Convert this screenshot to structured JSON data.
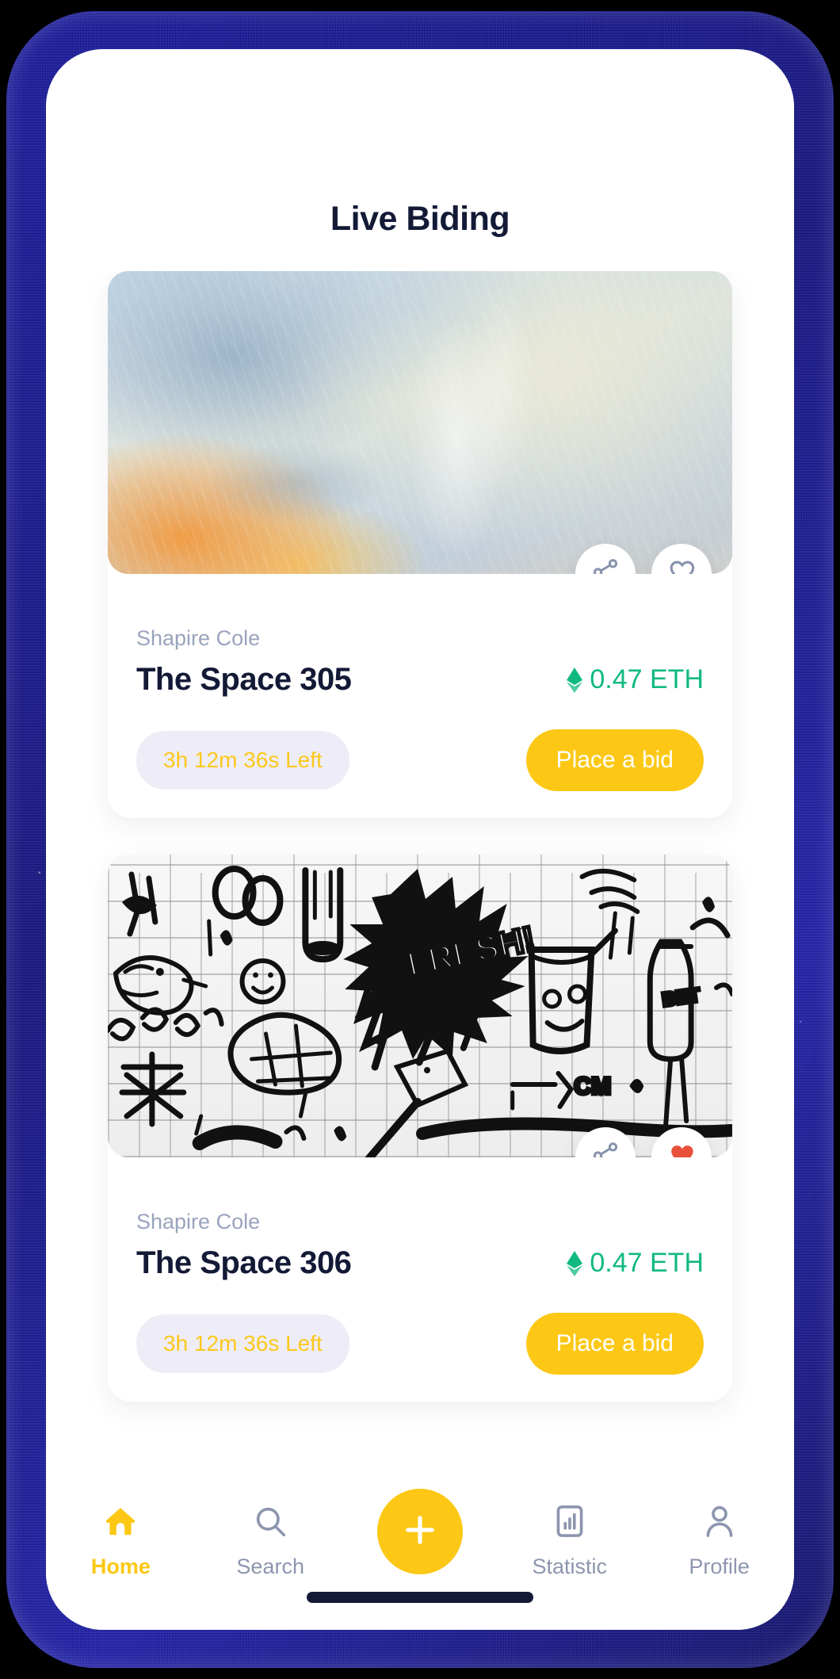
{
  "header": {
    "title": "Live Biding"
  },
  "cards": [
    {
      "author": "Shapire Cole",
      "name": "The Space 305",
      "price": "0.47 ETH",
      "timer": "3h 12m 36s Left",
      "bid_label": "Place a bid",
      "share_icon": "share-icon",
      "like_icon": "heart-outline-icon",
      "liked": false,
      "artwork": "abstract-marble-blue-orange"
    },
    {
      "author": "Shapire Cole",
      "name": "The Space 306",
      "price": "0.47 ETH",
      "timer": "3h 12m 36s Left",
      "bid_label": "Place a bid",
      "share_icon": "share-icon",
      "like_icon": "heart-filled-icon",
      "liked": true,
      "artwork": "graffiti-tile-wall-black-white"
    }
  ],
  "bottom_nav": {
    "items": [
      {
        "label": "Home",
        "icon": "home-icon",
        "active": true
      },
      {
        "label": "Search",
        "icon": "search-icon",
        "active": false
      },
      {
        "label": "Statistic",
        "icon": "chart-bar-icon",
        "active": false
      },
      {
        "label": "Profile",
        "icon": "person-icon",
        "active": false
      }
    ],
    "fab_icon": "plus-icon"
  },
  "colors": {
    "accent_yellow": "#FCC815",
    "title_navy": "#131A36",
    "muted_blue_gray": "#9AA4BD",
    "price_green": "#10B981",
    "heart_red": "#E8503A",
    "pill_lavender": "#EEEDF7",
    "frame_blue": "#1414A8"
  }
}
